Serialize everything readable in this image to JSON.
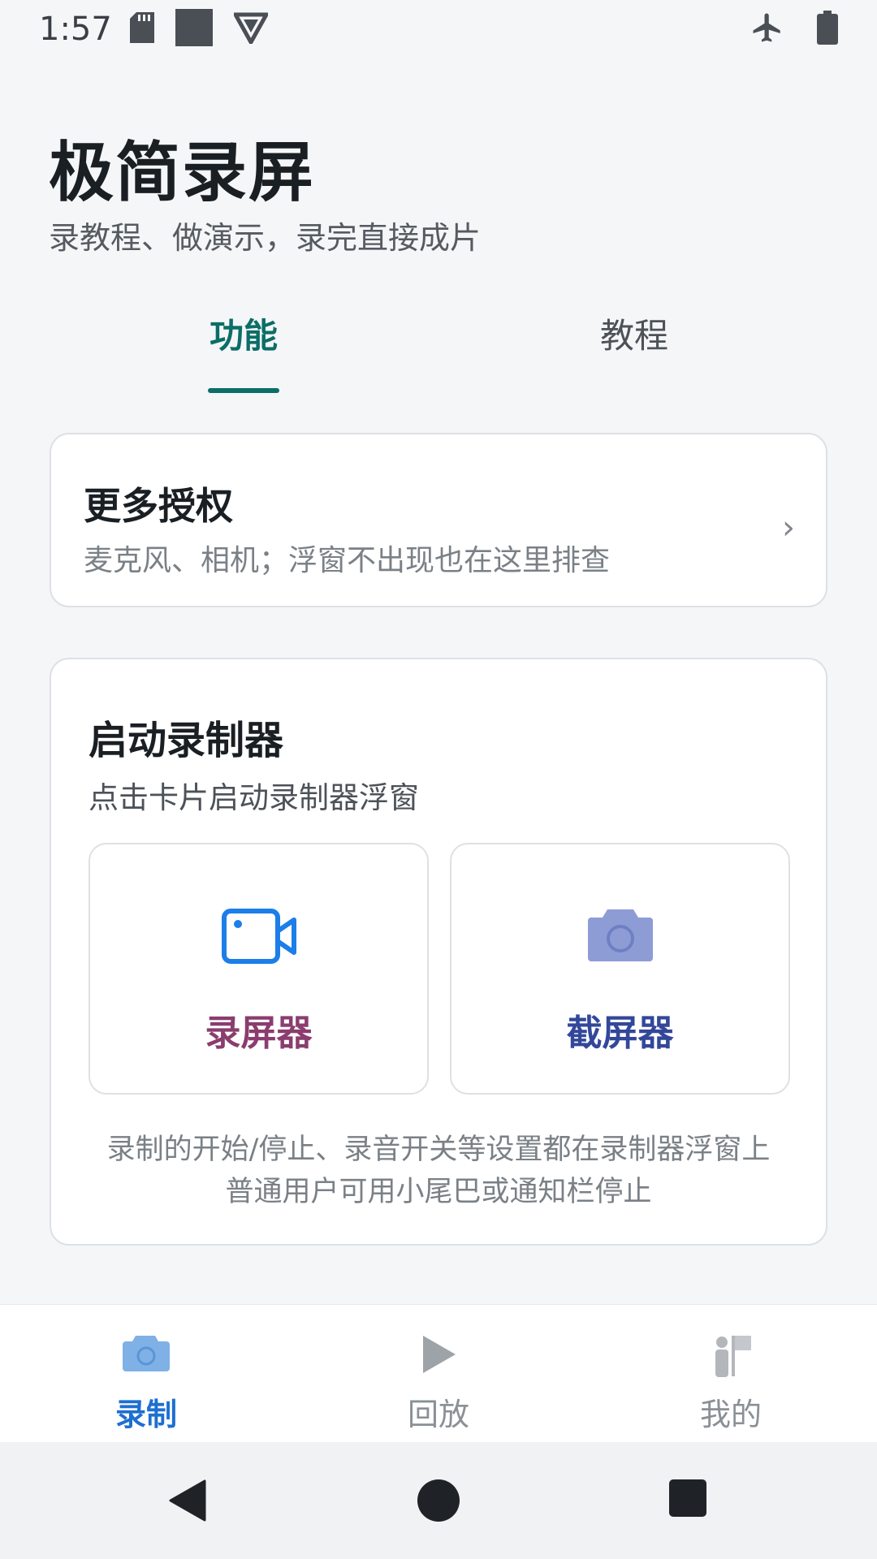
{
  "status_bar": {
    "time": "1:57",
    "icons_left": [
      "sd-card-icon",
      "square-icon",
      "shield-icon"
    ],
    "icons_right": [
      "airplane-icon",
      "battery-icon"
    ]
  },
  "header": {
    "title": "极简录屏",
    "subtitle": "录教程、做演示，录完直接成片"
  },
  "tabs": [
    {
      "label": "功能",
      "active": true
    },
    {
      "label": "教程",
      "active": false
    }
  ],
  "permission_card": {
    "title": "更多授权",
    "description": "麦克风、相机；浮窗不出现也在这里排查",
    "chevron": "›"
  },
  "recorder_card": {
    "title": "启动录制器",
    "subtitle": "点击卡片启动录制器浮窗",
    "options": [
      {
        "label": "录屏器",
        "icon": "video-camera-icon",
        "color": "#8a3d6e",
        "icon_color": "#1c7ee8"
      },
      {
        "label": "截屏器",
        "icon": "camera-icon",
        "color": "#33479a",
        "icon_color": "#8e9cd6"
      }
    ],
    "note_line1": "录制的开始/停止、录音开关等设置都在录制器浮窗上",
    "note_line2": "普通用户可用小尾巴或通知栏停止"
  },
  "bottom_nav": [
    {
      "label": "录制",
      "icon": "camera-icon",
      "active": true
    },
    {
      "label": "回放",
      "icon": "play-icon",
      "active": false
    },
    {
      "label": "我的",
      "icon": "person-flag-icon",
      "active": false
    }
  ],
  "colors": {
    "accent": "#0b6e67",
    "nav_active": "#1e6fd0",
    "background": "#f5f6f8"
  }
}
